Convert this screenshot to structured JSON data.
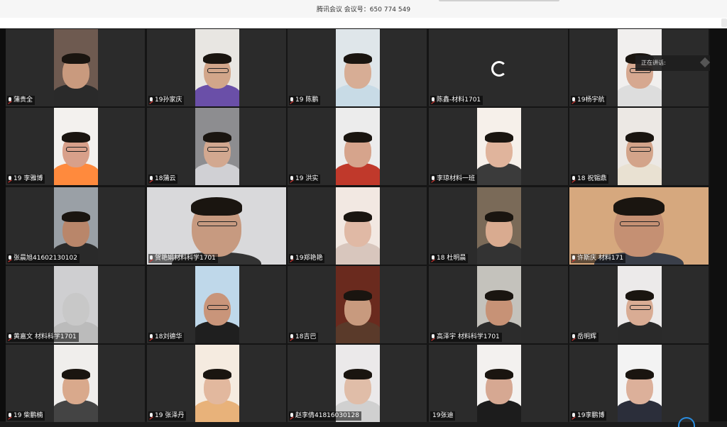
{
  "window": {
    "title": "腾讯会议 会议号：650 774 549"
  },
  "speaking_indicator": {
    "label": "正在讲话:"
  },
  "colors": {
    "tile_background": "#2b2b2b",
    "mic_muted": "#e53935",
    "stage_background": "#151515"
  },
  "participants": [
    {
      "name": "蒲贵全",
      "muted": true,
      "video": true
    },
    {
      "name": "19孙家庆",
      "muted": true,
      "video": true
    },
    {
      "name": "19  陈鹏",
      "muted": true,
      "video": true
    },
    {
      "name": "陈鑫-材料1701",
      "muted": true,
      "video": false,
      "loading": true
    },
    {
      "name": "19杨宇航",
      "muted": true,
      "video": true
    },
    {
      "name": "19 李雅博",
      "muted": true,
      "video": true
    },
    {
      "name": "18蒲云",
      "muted": true,
      "video": true
    },
    {
      "name": "19     洪实",
      "muted": true,
      "video": true
    },
    {
      "name": "李琼材料一班",
      "muted": true,
      "video": true
    },
    {
      "name": "18 祝锡鼎",
      "muted": true,
      "video": true
    },
    {
      "name": "张晨旭41602130102",
      "muted": true,
      "video": true
    },
    {
      "name": "贺艳娟材料科学1701",
      "muted": true,
      "video": true
    },
    {
      "name": "19郑艳艳",
      "muted": true,
      "video": true
    },
    {
      "name": "18 杜明晨",
      "muted": true,
      "video": true
    },
    {
      "name": "许斯庆 材料171",
      "muted": true,
      "video": true
    },
    {
      "name": "黄嘉文 材料科学1701",
      "muted": true,
      "video": true
    },
    {
      "name": "18刘德华",
      "muted": true,
      "video": true
    },
    {
      "name": "18吉巴",
      "muted": true,
      "video": true
    },
    {
      "name": "高泽宇 材料科学1701",
      "muted": true,
      "video": true
    },
    {
      "name": "岳明辉",
      "muted": true,
      "video": true
    },
    {
      "name": "19 柴鹏楠",
      "muted": true,
      "video": true
    },
    {
      "name": "19 张泽丹",
      "muted": true,
      "video": true
    },
    {
      "name": "赵李倩41816030128",
      "muted": true,
      "video": true
    },
    {
      "name": "19张迪",
      "muted": false,
      "video": true
    },
    {
      "name": "19李鹏博",
      "muted": true,
      "video": true
    }
  ]
}
